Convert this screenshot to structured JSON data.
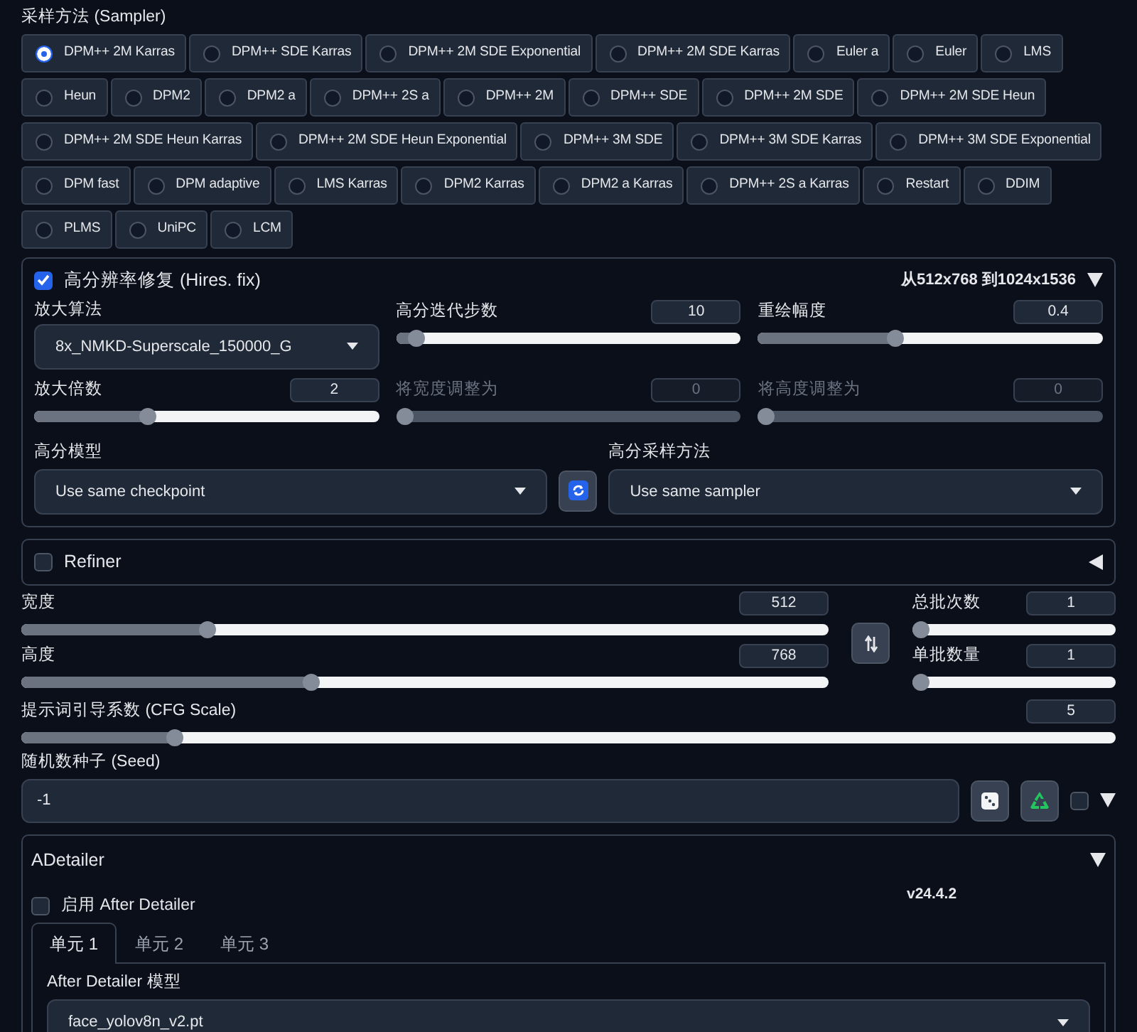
{
  "sampler": {
    "label": "采样方法 (Sampler)",
    "options": [
      {
        "label": "DPM++ 2M Karras",
        "selected": true
      },
      {
        "label": "DPM++ SDE Karras",
        "selected": false
      },
      {
        "label": "DPM++ 2M SDE Exponential",
        "selected": false
      },
      {
        "label": "DPM++ 2M SDE Karras",
        "selected": false
      },
      {
        "label": "Euler a",
        "selected": false
      },
      {
        "label": "Euler",
        "selected": false
      },
      {
        "label": "LMS",
        "selected": false
      },
      {
        "label": "Heun",
        "selected": false
      },
      {
        "label": "DPM2",
        "selected": false
      },
      {
        "label": "DPM2 a",
        "selected": false
      },
      {
        "label": "DPM++ 2S a",
        "selected": false
      },
      {
        "label": "DPM++ 2M",
        "selected": false
      },
      {
        "label": "DPM++ SDE",
        "selected": false
      },
      {
        "label": "DPM++ 2M SDE",
        "selected": false
      },
      {
        "label": "DPM++ 2M SDE Heun",
        "selected": false
      },
      {
        "label": "DPM++ 2M SDE Heun Karras",
        "selected": false
      },
      {
        "label": "DPM++ 2M SDE Heun Exponential",
        "selected": false
      },
      {
        "label": "DPM++ 3M SDE",
        "selected": false
      },
      {
        "label": "DPM++ 3M SDE Karras",
        "selected": false
      },
      {
        "label": "DPM++ 3M SDE Exponential",
        "selected": false
      },
      {
        "label": "DPM fast",
        "selected": false
      },
      {
        "label": "DPM adaptive",
        "selected": false
      },
      {
        "label": "LMS Karras",
        "selected": false
      },
      {
        "label": "DPM2 Karras",
        "selected": false
      },
      {
        "label": "DPM2 a Karras",
        "selected": false
      },
      {
        "label": "DPM++ 2S a Karras",
        "selected": false
      },
      {
        "label": "Restart",
        "selected": false
      },
      {
        "label": "DDIM",
        "selected": false
      },
      {
        "label": "PLMS",
        "selected": false
      },
      {
        "label": "UniPC",
        "selected": false
      },
      {
        "label": "LCM",
        "selected": false
      }
    ]
  },
  "hires": {
    "title": "高分辨率修复 (Hires. fix)",
    "checked": true,
    "summary": "从512x768 到1024x1536",
    "expanded": true,
    "upscaler": {
      "label": "放大算法",
      "value": "8x_NMKD-Superscale_150000_G"
    },
    "sliders": [
      {
        "label": "高分迭代步数",
        "value": "10",
        "level": 0.06,
        "disabled": false
      },
      {
        "label": "重绘幅度",
        "value": "0.4",
        "level": 0.4,
        "disabled": false
      },
      {
        "label": "放大倍数",
        "value": "2",
        "level": 0.33,
        "disabled": false
      },
      {
        "label": "将宽度调整为",
        "value": "0",
        "level": 0,
        "disabled": true
      },
      {
        "label": "将高度调整为",
        "value": "0",
        "level": 0,
        "disabled": true
      }
    ],
    "model": {
      "label": "高分模型",
      "value": "Use same checkpoint"
    },
    "sampler": {
      "label": "高分采样方法",
      "value": "Use same sampler"
    }
  },
  "refiner": {
    "title": "Refiner",
    "checked": false,
    "expanded": false
  },
  "size": {
    "width": {
      "label": "宽度",
      "value": "512",
      "level": 0.23
    },
    "height": {
      "label": "高度",
      "value": "768",
      "level": 0.36
    }
  },
  "batch": [
    {
      "label": "总批次数",
      "value": "1",
      "level": 0
    },
    {
      "label": "单批数量",
      "value": "1",
      "level": 0
    }
  ],
  "cfg": {
    "label": "提示词引导系数 (CFG Scale)",
    "value": "5",
    "level": 0.14
  },
  "seed": {
    "label": "随机数种子 (Seed)",
    "value": "-1",
    "extra_checked": false,
    "expanded": true
  },
  "adetailer": {
    "title": "ADetailer",
    "expanded": true,
    "enable": {
      "label": "启用 After Detailer",
      "checked": false
    },
    "version": "v24.4.2",
    "tabs": [
      {
        "label": "单元 1",
        "selected": true
      },
      {
        "label": "单元 2",
        "selected": false
      },
      {
        "label": "单元 3",
        "selected": false
      }
    ],
    "model": {
      "label": "After Detailer 模型",
      "value": "face_yolov8n_v2.pt"
    }
  }
}
